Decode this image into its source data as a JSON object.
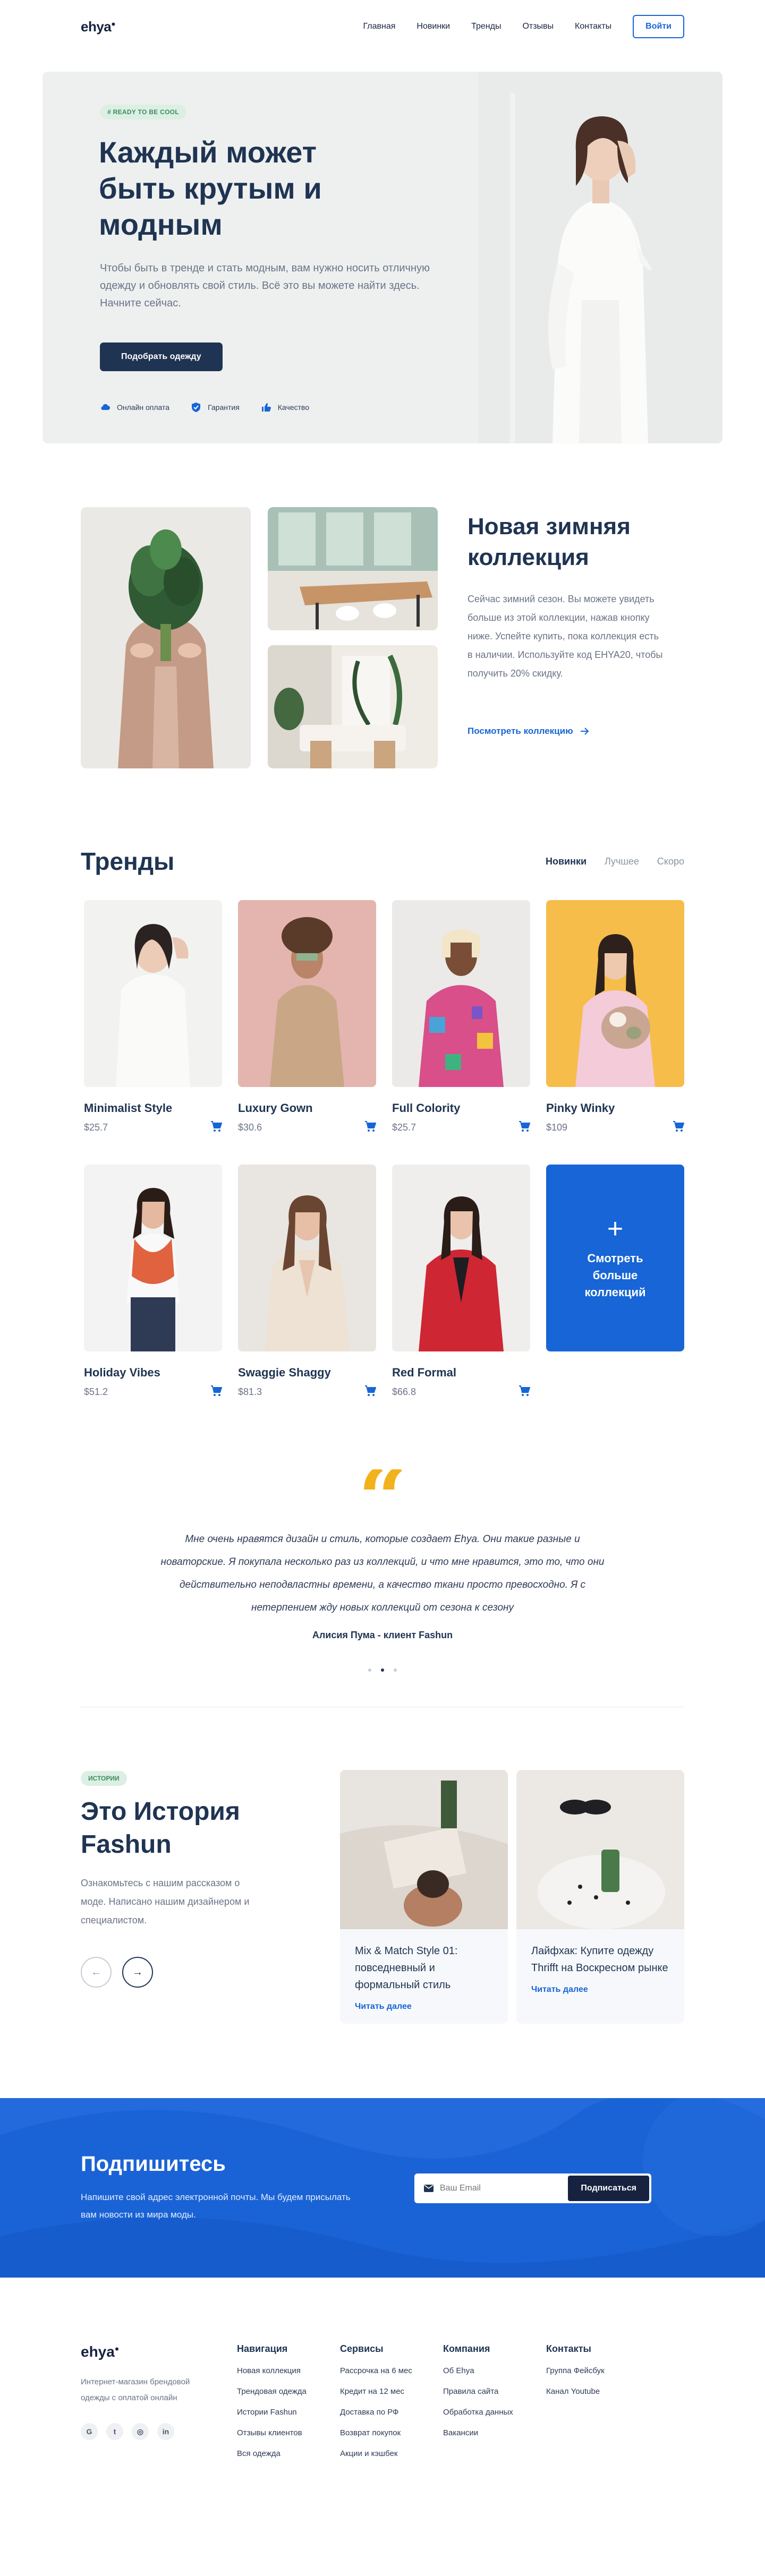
{
  "header": {
    "logo": "ehya",
    "nav": [
      "Главная",
      "Новинки",
      "Тренды",
      "Отзывы",
      "Контакты"
    ],
    "login": "Войти"
  },
  "hero": {
    "badge": "# READY TO BE COOL",
    "title": "Каждый может быть крутым и модным",
    "text": "Чтобы быть в тренде и стать модным, вам нужно носить отличную одежду и обновлять свой стиль. Всё это вы можете найти здесь. Начните сейчас.",
    "button": "Подобрать одежду",
    "features": [
      "Онлайн оплата",
      "Гарантия",
      "Качество"
    ]
  },
  "collection": {
    "title": "Новая зимняя коллекция",
    "text": "Сейчас зимний сезон. Вы можете увидеть больше из этой коллекции, нажав кнопку ниже. Успейте купить, пока коллекция есть в наличии. Используйте код EHYA20, чтобы получить 20% скидку.",
    "link": "Посмотреть коллекцию"
  },
  "trends": {
    "title": "Тренды",
    "tabs": [
      "Новинки",
      "Лучшее",
      "Скоро"
    ],
    "products": [
      {
        "name": "Minimalist Style",
        "price": "$25.7"
      },
      {
        "name": "Luxury Gown",
        "price": "$30.6"
      },
      {
        "name": "Full Colority",
        "price": "$25.7"
      },
      {
        "name": "Pinky Winky",
        "price": "$109"
      },
      {
        "name": "Holiday Vibes",
        "price": "$51.2"
      },
      {
        "name": "Swaggie Shaggy",
        "price": "$81.3"
      },
      {
        "name": "Red Formal",
        "price": "$66.8"
      }
    ],
    "more_plus": "+",
    "more_label": "Смотреть больше коллекций"
  },
  "testimonial": {
    "mark": "“",
    "text": "Мне очень нравятся дизайн и стиль, которые создает Ehya. Они такие разные и новаторские. Я покупала несколько раз из коллекций, и что мне нравится, это то, что они действительно неподвластны времени, а качество ткани просто превосходно. Я с нетерпением жду новых коллекций от сезона к сезону",
    "author": "Алисия Пума - клиент Fashun"
  },
  "stories": {
    "badge": "ИСТОРИИ",
    "title": "Это История Fashun",
    "text": "Ознакомьтесь с нашим рассказом о моде. Написано нашим дизайнером и специалистом.",
    "prev": "←",
    "next": "→",
    "items": [
      {
        "title": "Mix & Match Style 01: повседневный и формальный стиль",
        "link": "Читать далее"
      },
      {
        "title": "Лайфхак: Купите одежду Thrifft на Воскресном рынке",
        "link": "Читать далее"
      }
    ]
  },
  "subscribe": {
    "title": "Подпишитесь",
    "text": "Напишите свой адрес электронной почты. Мы будем присылать вам новости из мира моды.",
    "placeholder": "Ваш Email",
    "button": "Подписаться"
  },
  "footer": {
    "logo": "ehya",
    "desc": "Интернет-магазин брендовой одежды с оплатой онлайн",
    "social": [
      "G",
      "t",
      "◎",
      "in"
    ],
    "columns": [
      {
        "title": "Навигация",
        "links": [
          "Новая коллекция",
          "Трендовая одежда",
          "Истории Fashun",
          "Отзывы клиентов",
          "Вся одежда"
        ]
      },
      {
        "title": "Сервисы",
        "links": [
          "Рассрочка на 6 мес",
          "Кредит на 12 мес",
          "Доставка по РФ",
          "Возврат покупок",
          "Акции и кэшбек"
        ]
      },
      {
        "title": "Компания",
        "links": [
          "Об Ehya",
          "Правила сайта",
          "Обработка данных",
          "Вакансии"
        ]
      },
      {
        "title": "Контакты",
        "links": [
          "Группа Фейсбук",
          "Канал Youtube"
        ]
      }
    ]
  },
  "colors": {
    "brand": "#1765d6",
    "navy": "#1f3452",
    "accent": "#f2b21b",
    "badge": "#dcefe4"
  }
}
